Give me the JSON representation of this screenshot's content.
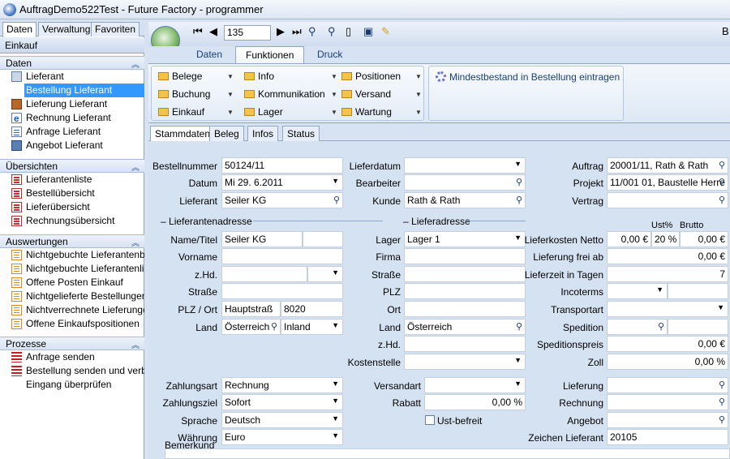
{
  "window": {
    "title": "AuftragDemo522Test - Future Factory - programmer"
  },
  "left": {
    "tabs": [
      "Daten",
      "Verwaltung",
      "Favoriten"
    ],
    "module": "Einkauf",
    "sections": [
      {
        "title": "Daten",
        "items": [
          "Lieferant",
          "Bestellung Lieferant",
          "Lieferung Lieferant",
          "Rechnung Lieferant",
          "Anfrage Lieferant",
          "Angebot Lieferant"
        ]
      },
      {
        "title": "Übersichten",
        "items": [
          "Lieferantenliste",
          "Bestellübersicht",
          "Lieferübersicht",
          "Rechnungsübersicht"
        ]
      },
      {
        "title": "Auswertungen",
        "items": [
          "Nichtgebuchte Lieferantenb...",
          "Nichtgebuchte Lieferantenli...",
          "Offene Posten Einkauf",
          "Nichtgelieferte Bestellungen",
          "Nichtverrechnete Lieferungen",
          "Offene Einkaufspositionen"
        ]
      },
      {
        "title": "Prozesse",
        "items": [
          "Anfrage senden",
          "Bestellung senden und verb...",
          "Eingang überprüfen"
        ]
      }
    ]
  },
  "toolbar": {
    "record": "135",
    "corner": "B"
  },
  "ribbon": {
    "tabs": [
      "Daten",
      "Funktionen",
      "Druck"
    ],
    "col1": [
      "Belege",
      "Buchung",
      "Einkauf"
    ],
    "col2": [
      "Info",
      "Kommunikation",
      "Lager"
    ],
    "col3": [
      "Positionen",
      "Versand",
      "Wartung"
    ],
    "mindest": "Mindestbestand in Bestellung eintragen"
  },
  "subtabs": [
    "Stammdaten",
    "Beleg",
    "Infos",
    "Status"
  ],
  "form": {
    "bestellnummer_lbl": "Bestellnummer",
    "bestellnummer": "50124/11",
    "datum_lbl": "Datum",
    "datum": "Mi 29.  6.2011",
    "lieferant_lbl": "Lieferant",
    "lieferant": "Seiler KG",
    "lieferdatum_lbl": "Lieferdatum",
    "bearbeiter_lbl": "Bearbeiter",
    "kunde_lbl": "Kunde",
    "kunde": "Rath & Rath",
    "auftrag_lbl": "Auftrag",
    "auftrag": "20001/11, Rath & Rath",
    "projekt_lbl": "Projekt",
    "projekt": "11/001 01, Baustelle Herre",
    "vertrag_lbl": "Vertrag",
    "la_section": "Lieferantenadresse",
    "lf_section": "Lieferadresse",
    "ust_hdr": "Ust%",
    "brutto_hdr": "Brutto",
    "name_lbl": "Name/Titel",
    "name": "Seiler KG",
    "vorname_lbl": "Vorname",
    "zhd_lbl": "z.Hd.",
    "strasse_lbl": "Straße",
    "plzort_lbl": "PLZ / Ort",
    "strasse_val": "Hauptstraß",
    "plz_val": "8020",
    "land_lbl": "Land",
    "land_val": "Österreich",
    "inland": "Inland",
    "lager_lbl": "Lager",
    "lager": "Lager 1",
    "firma_lbl": "Firma",
    "strasse2_lbl": "Straße",
    "plz2_lbl": "PLZ",
    "ort2_lbl": "Ort",
    "land2_lbl": "Land",
    "land2": "Österreich",
    "zhd2_lbl": "z.Hd.",
    "kostenstelle_lbl": "Kostenstelle",
    "lkn_lbl": "Lieferkosten Netto",
    "lkn_val": "0,00 €",
    "lkn_ust": "20 %",
    "lkn_brutto": "0,00 €",
    "lfa_lbl": "Lieferung frei ab",
    "lfa_val": "0,00 €",
    "lzt_lbl": "Lieferzeit in Tagen",
    "lzt_val": "7",
    "inco_lbl": "Incoterms",
    "trans_lbl": "Transportart",
    "sped_lbl": "Spedition",
    "spreis_lbl": "Speditionspreis",
    "spreis_val": "0,00 €",
    "zoll_lbl": "Zoll",
    "zoll_val": "0,00 %",
    "zart_lbl": "Zahlungsart",
    "zart": "Rechnung",
    "zziel_lbl": "Zahlungsziel",
    "zziel": "Sofort",
    "sprache_lbl": "Sprache",
    "sprache": "Deutsch",
    "waehrung_lbl": "Währung",
    "waehrung": "Euro",
    "bemerkung_lbl": "Bemerkung",
    "versandart_lbl": "Versandart",
    "rabatt_lbl": "Rabatt",
    "rabatt_val": "0,00 %",
    "ustbefreit_lbl": "Ust-befreit",
    "lieferung_lbl": "Lieferung",
    "rechnung_lbl": "Rechnung",
    "angebot_lbl": "Angebot",
    "zeichen_lbl": "Zeichen Lieferant",
    "zeichen": "20105"
  }
}
